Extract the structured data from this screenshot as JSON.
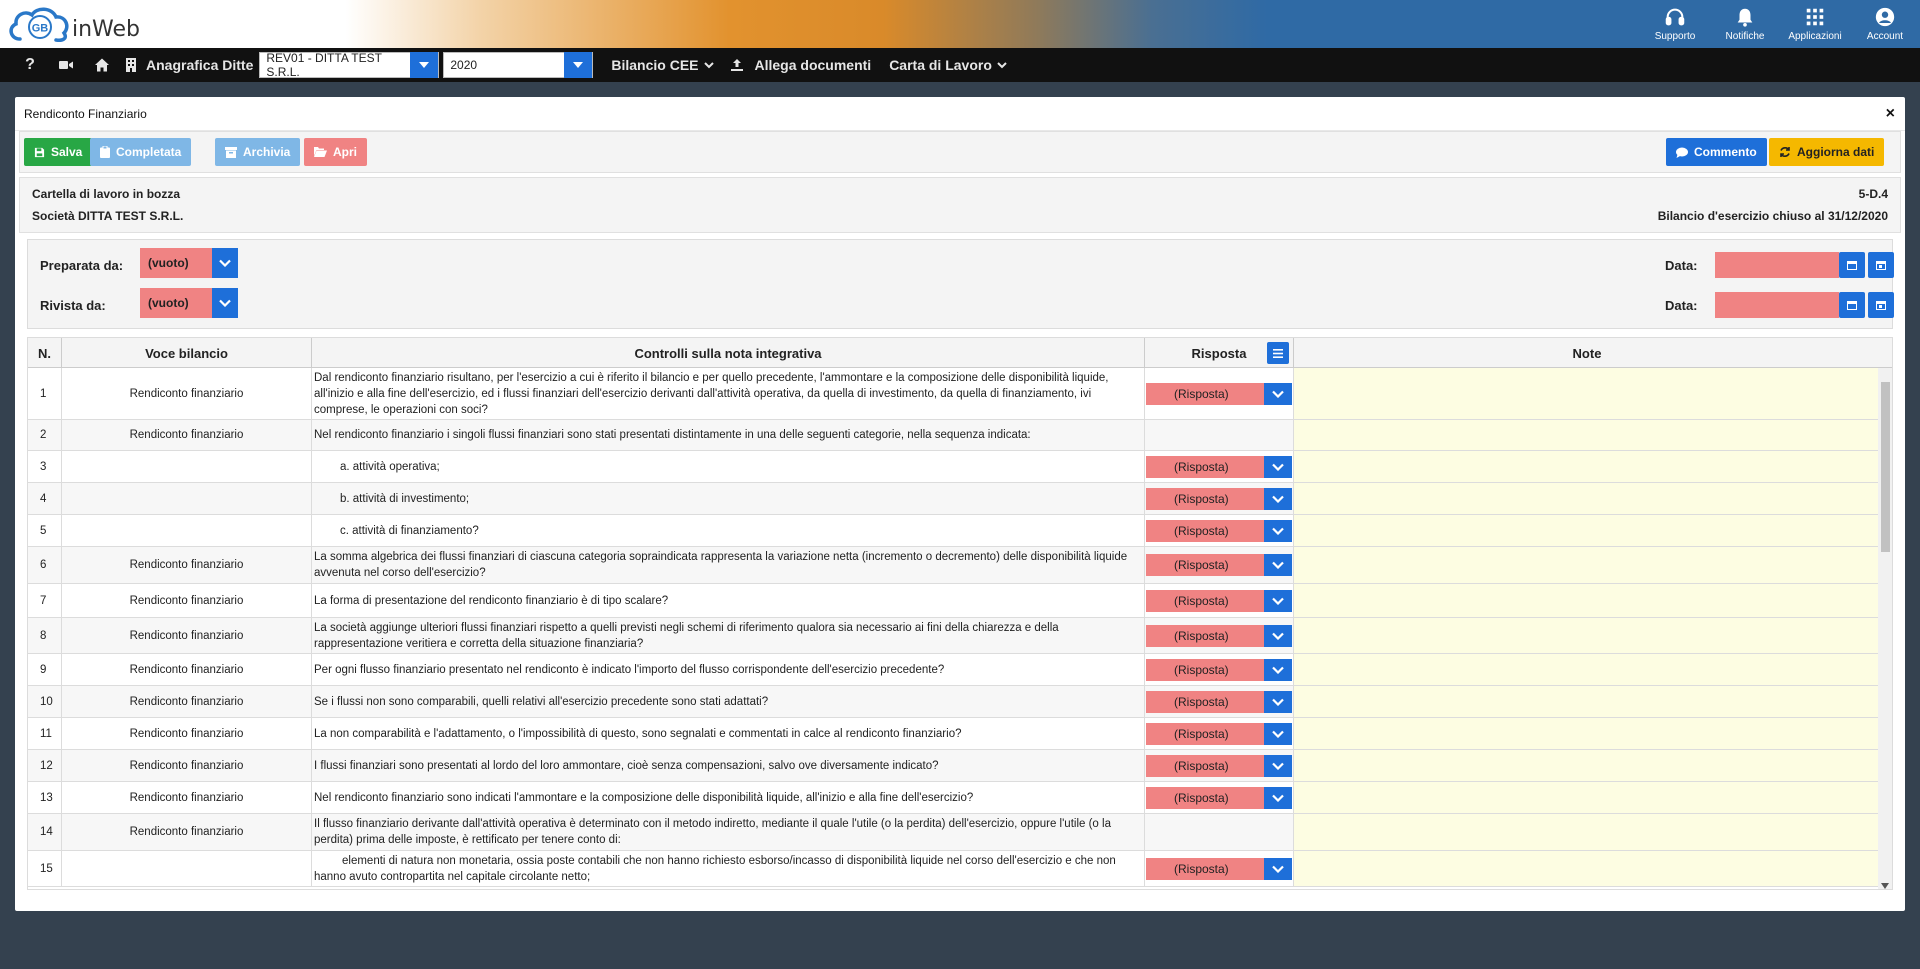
{
  "app": {
    "logo_text": "inWeb",
    "logo_mark": "GB"
  },
  "top_actions": [
    {
      "label": "Supporto",
      "icon": "headset-icon"
    },
    {
      "label": "Notifiche",
      "icon": "bell-icon"
    },
    {
      "label": "Applicazioni",
      "icon": "grid-icon"
    },
    {
      "label": "Account",
      "icon": "user-circle-icon"
    }
  ],
  "navbar": {
    "help": "?",
    "anagrafica_label": "Anagrafica Ditte",
    "ditta_value": "REV01 - DITTA TEST S.R.L.",
    "year_value": "2020",
    "menu_bilancio": "Bilancio CEE",
    "menu_allega": "Allega documenti",
    "menu_carta": "Carta di Lavoro"
  },
  "dialog": {
    "title": "Rendiconto Finanziario",
    "close": "×",
    "toolbar": {
      "salva": "Salva",
      "completata": "Completata",
      "archivia": "Archivia",
      "apri": "Apri",
      "commento": "Commento",
      "aggiorna": "Aggiorna dati"
    },
    "info": {
      "status": "Cartella di lavoro in bozza",
      "societa": "Società DITTA TEST S.R.L.",
      "code": "5-D.4",
      "bilancio": "Bilancio d'esercizio chiuso al 31/12/2020"
    },
    "signatures": {
      "preparata_label": "Preparata da:",
      "preparata_value": "(vuoto)",
      "rivista_label": "Rivista da:",
      "rivista_value": "(vuoto)",
      "data_label": "Data:"
    },
    "table": {
      "headers": {
        "n": "N.",
        "voce": "Voce bilancio",
        "controlli": "Controlli sulla nota integrativa",
        "risposta": "Risposta",
        "note": "Note"
      },
      "response_placeholder": "(Risposta)",
      "rows": [
        {
          "n": "1",
          "voce": "Rendiconto finanziario",
          "text": "Dal rendiconto finanziario risultano, per l'esercizio a cui è riferito il bilancio e per quello precedente, l'ammontare e la composizione delle disponibilità liquide, all'inizio e alla fine dell'esercizio, ed i flussi finanziari dell'esercizio derivanti dall'attività operativa, da quella di investimento, da quella di finanziamento, ivi comprese, le operazioni con soci?",
          "has_resp": true,
          "indent": false
        },
        {
          "n": "2",
          "voce": "Rendiconto finanziario",
          "text": "Nel rendiconto finanziario i singoli flussi finanziari sono stati presentati distintamente in una delle seguenti categorie, nella sequenza indicata:",
          "has_resp": false,
          "indent": false
        },
        {
          "n": "3",
          "voce": "",
          "text": "a. attività operativa;",
          "has_resp": true,
          "indent": true
        },
        {
          "n": "4",
          "voce": "",
          "text": "b. attività di investimento;",
          "has_resp": true,
          "indent": true
        },
        {
          "n": "5",
          "voce": "",
          "text": "c. attività di finanziamento?",
          "has_resp": true,
          "indent": true
        },
        {
          "n": "6",
          "voce": "Rendiconto finanziario",
          "text": "La somma algebrica dei flussi finanziari di ciascuna categoria sopraindicata rappresenta la variazione netta (incremento o decremento) delle disponibilità liquide avvenuta nel corso dell'esercizio?",
          "has_resp": true,
          "indent": false
        },
        {
          "n": "7",
          "voce": "Rendiconto finanziario",
          "text": "La forma di presentazione del rendiconto finanziario è di tipo scalare?",
          "has_resp": true,
          "indent": false
        },
        {
          "n": "8",
          "voce": "Rendiconto finanziario",
          "text": "La società aggiunge ulteriori flussi finanziari rispetto a quelli previsti negli schemi di riferimento qualora sia necessario ai fini della chiarezza e della rappresentazione veritiera e corretta della situazione finanziaria?",
          "has_resp": true,
          "indent": false
        },
        {
          "n": "9",
          "voce": "Rendiconto finanziario",
          "text": "Per ogni flusso finanziario presentato nel rendiconto è indicato l'importo del flusso corrispondente dell'esercizio precedente?",
          "has_resp": true,
          "indent": false
        },
        {
          "n": "10",
          "voce": "Rendiconto finanziario",
          "text": "Se i flussi non sono comparabili, quelli relativi all'esercizio precedente sono stati adattati?",
          "has_resp": true,
          "indent": false
        },
        {
          "n": "11",
          "voce": "Rendiconto finanziario",
          "text": "La non comparabilità e l'adattamento, o l'impossibilità di questo, sono segnalati e commentati in calce al rendiconto finanziario?",
          "has_resp": true,
          "indent": false
        },
        {
          "n": "12",
          "voce": "Rendiconto finanziario",
          "text": "I flussi finanziari sono presentati al lordo del loro ammontare, cioè senza compensazioni, salvo ove diversamente indicato?",
          "has_resp": true,
          "indent": false
        },
        {
          "n": "13",
          "voce": "Rendiconto finanziario",
          "text": "Nel rendiconto finanziario sono indicati l'ammontare e la composizione delle disponibilità liquide, all'inizio e alla fine dell'esercizio?",
          "has_resp": true,
          "indent": false
        },
        {
          "n": "14",
          "voce": "Rendiconto finanziario",
          "text": "Il flusso finanziario derivante dall'attività operativa è determinato con il metodo indiretto, mediante il quale l'utile (o la perdita) dell'esercizio, oppure l'utile (o la perdita) prima delle imposte, è rettificato per tenere conto di:",
          "has_resp": false,
          "indent": false
        },
        {
          "n": "15",
          "voce": "",
          "text": "elementi di natura non monetaria, ossia poste contabili che non hanno richiesto esborso/incasso di disponibilità liquide nel corso dell'esercizio e che non hanno avuto contropartita nel capitale circolante netto;",
          "has_resp": true,
          "indent": false,
          "first_line_indent": true
        }
      ]
    }
  },
  "colors": {
    "primary": "#1e6fd9",
    "danger_fill": "#f08383",
    "success": "#28a745",
    "warning": "#f5b800",
    "note_bg": "#fdfde2"
  }
}
